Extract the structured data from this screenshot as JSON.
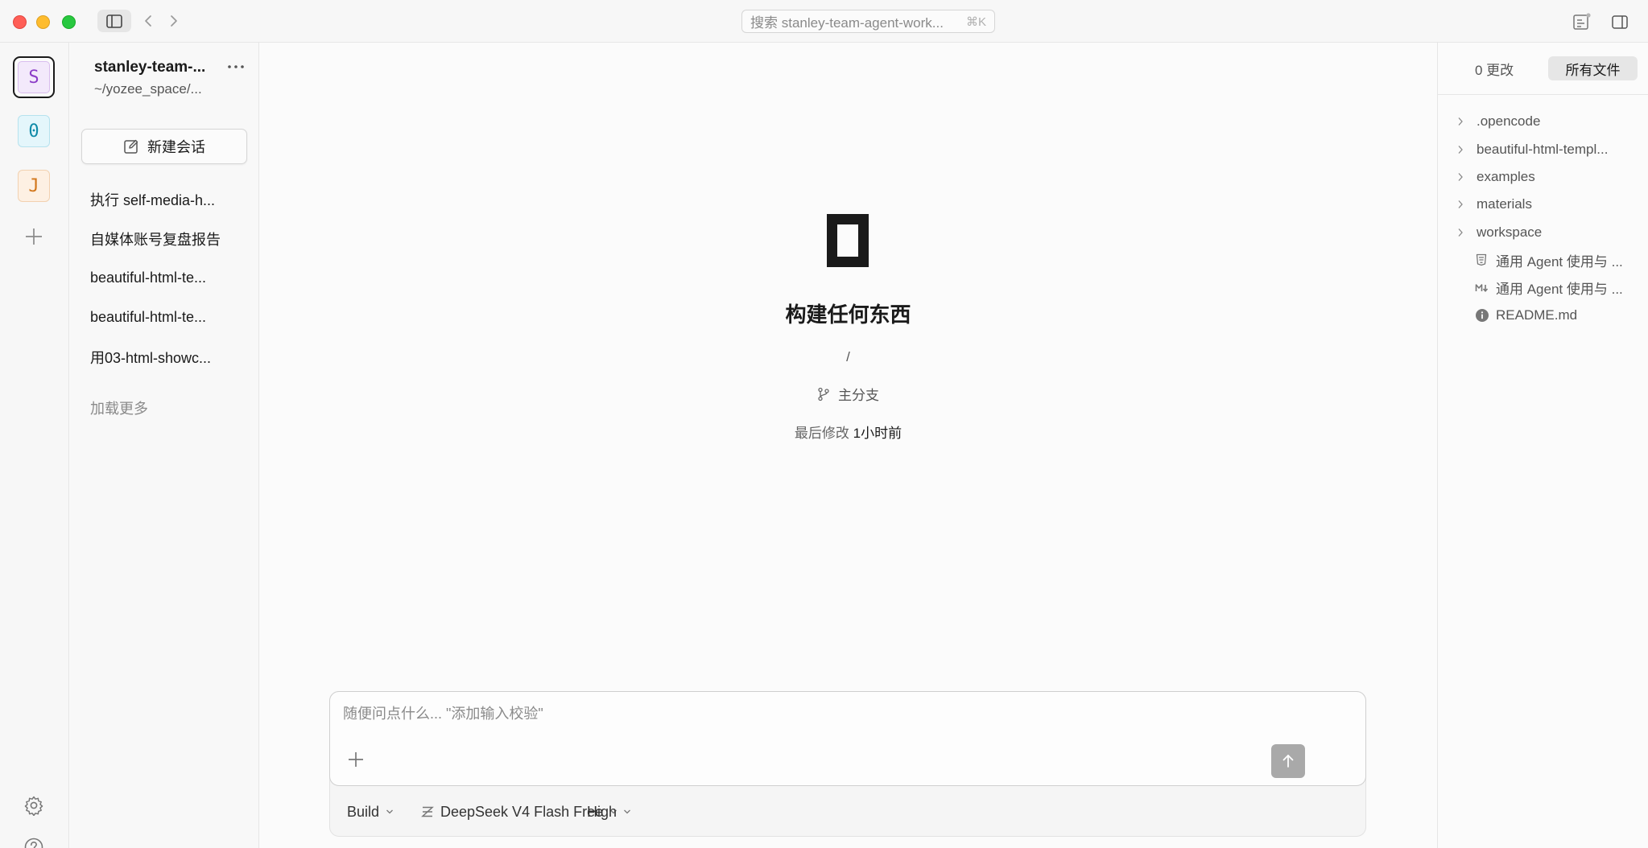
{
  "titlebar": {
    "search_placeholder": "搜索 stanley-team-agent-work...",
    "search_shortcut": "⌘K"
  },
  "rail": {
    "projects": [
      {
        "letter": "S",
        "color": "#8b3cc7"
      },
      {
        "letter": "0",
        "color": "#0f8aa8"
      },
      {
        "letter": "J",
        "color": "#d2761b"
      }
    ]
  },
  "sidebar": {
    "workspace_name": "stanley-team-...",
    "workspace_path": "~/yozee_space/...",
    "new_chat_label": "新建会话",
    "sessions": [
      {
        "label": "执行 self-media-h..."
      },
      {
        "label": "自媒体账号复盘报告"
      },
      {
        "label": "beautiful-html-te..."
      },
      {
        "label": "beautiful-html-te..."
      },
      {
        "label": "用03-html-showc..."
      }
    ],
    "load_more": "加载更多"
  },
  "main": {
    "headline": "构建任何东西",
    "path": "/",
    "branch": "主分支",
    "modified_label": "最后修改",
    "modified_value": "1小时前"
  },
  "composer": {
    "placeholder": "随便问点什么... \"添加输入校验\"",
    "mode": "Build",
    "model": "DeepSeek V4 Flash Free",
    "effort": "High"
  },
  "right_panel": {
    "changes_tab": "0 更改",
    "all_files_tab": "所有文件",
    "tree": [
      {
        "name": ".opencode",
        "type": "folder"
      },
      {
        "name": "beautiful-html-templ...",
        "type": "folder"
      },
      {
        "name": "examples",
        "type": "folder"
      },
      {
        "name": "materials",
        "type": "folder"
      },
      {
        "name": "workspace",
        "type": "folder"
      },
      {
        "name": "通用 Agent 使用与 ...",
        "type": "html-file"
      },
      {
        "name": "通用 Agent 使用与 ...",
        "type": "markdown-file"
      },
      {
        "name": "README.md",
        "type": "info-file"
      }
    ]
  }
}
